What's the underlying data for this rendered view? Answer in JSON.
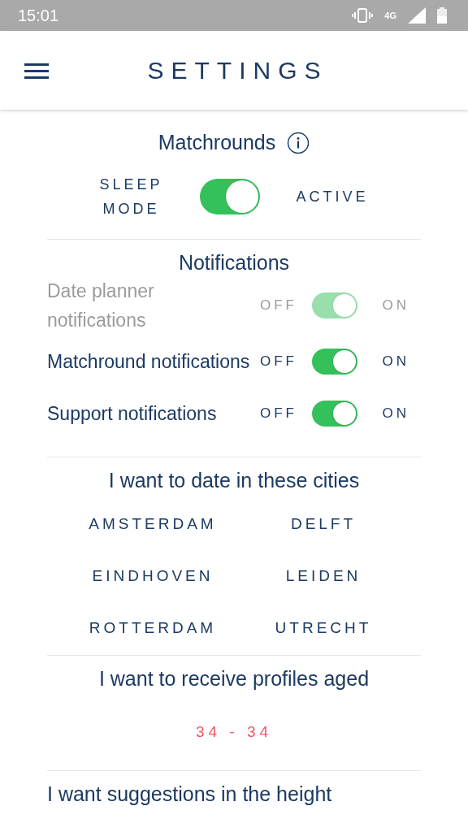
{
  "status_bar": {
    "time": "15:01",
    "network": "4G"
  },
  "header": {
    "title": "SETTINGS"
  },
  "matchrounds": {
    "title": "Matchrounds",
    "left_label": "SLEEP\nMODE",
    "right_label": "ACTIVE",
    "on": true
  },
  "notifications": {
    "title": "Notifications",
    "items": [
      {
        "label": "Date planner notifications",
        "off_label": "OFF",
        "on_label": "ON",
        "on": true,
        "disabled": true
      },
      {
        "label": "Matchround notifications",
        "off_label": "OFF",
        "on_label": "ON",
        "on": true,
        "disabled": false
      },
      {
        "label": "Support notifications",
        "off_label": "OFF",
        "on_label": "ON",
        "on": true,
        "disabled": false
      }
    ]
  },
  "cities": {
    "title": "I want to date in these cities",
    "items": [
      "AMSTERDAM",
      "DELFT",
      "EINDHOVEN",
      "LEIDEN",
      "ROTTERDAM",
      "UTRECHT"
    ]
  },
  "age": {
    "title": "I want to receive profiles aged",
    "range": "34 - 34"
  },
  "height": {
    "title": "I want suggestions in the height"
  }
}
